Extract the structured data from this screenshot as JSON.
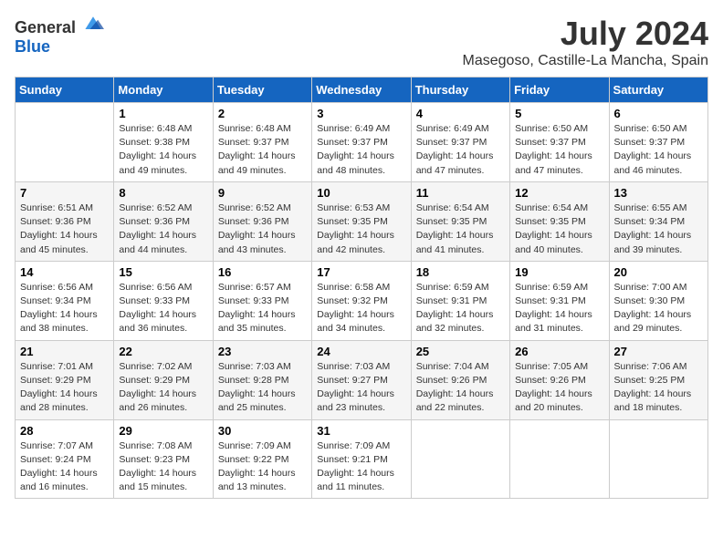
{
  "header": {
    "logo_general": "General",
    "logo_blue": "Blue",
    "title": "July 2024",
    "subtitle": "Masegoso, Castille-La Mancha, Spain"
  },
  "weekdays": [
    "Sunday",
    "Monday",
    "Tuesday",
    "Wednesday",
    "Thursday",
    "Friday",
    "Saturday"
  ],
  "weeks": [
    [
      {
        "day": "",
        "sunrise": "",
        "sunset": "",
        "daylight": ""
      },
      {
        "day": "1",
        "sunrise": "Sunrise: 6:48 AM",
        "sunset": "Sunset: 9:38 PM",
        "daylight": "Daylight: 14 hours and 49 minutes."
      },
      {
        "day": "2",
        "sunrise": "Sunrise: 6:48 AM",
        "sunset": "Sunset: 9:37 PM",
        "daylight": "Daylight: 14 hours and 49 minutes."
      },
      {
        "day": "3",
        "sunrise": "Sunrise: 6:49 AM",
        "sunset": "Sunset: 9:37 PM",
        "daylight": "Daylight: 14 hours and 48 minutes."
      },
      {
        "day": "4",
        "sunrise": "Sunrise: 6:49 AM",
        "sunset": "Sunset: 9:37 PM",
        "daylight": "Daylight: 14 hours and 47 minutes."
      },
      {
        "day": "5",
        "sunrise": "Sunrise: 6:50 AM",
        "sunset": "Sunset: 9:37 PM",
        "daylight": "Daylight: 14 hours and 47 minutes."
      },
      {
        "day": "6",
        "sunrise": "Sunrise: 6:50 AM",
        "sunset": "Sunset: 9:37 PM",
        "daylight": "Daylight: 14 hours and 46 minutes."
      }
    ],
    [
      {
        "day": "7",
        "sunrise": "Sunrise: 6:51 AM",
        "sunset": "Sunset: 9:36 PM",
        "daylight": "Daylight: 14 hours and 45 minutes."
      },
      {
        "day": "8",
        "sunrise": "Sunrise: 6:52 AM",
        "sunset": "Sunset: 9:36 PM",
        "daylight": "Daylight: 14 hours and 44 minutes."
      },
      {
        "day": "9",
        "sunrise": "Sunrise: 6:52 AM",
        "sunset": "Sunset: 9:36 PM",
        "daylight": "Daylight: 14 hours and 43 minutes."
      },
      {
        "day": "10",
        "sunrise": "Sunrise: 6:53 AM",
        "sunset": "Sunset: 9:35 PM",
        "daylight": "Daylight: 14 hours and 42 minutes."
      },
      {
        "day": "11",
        "sunrise": "Sunrise: 6:54 AM",
        "sunset": "Sunset: 9:35 PM",
        "daylight": "Daylight: 14 hours and 41 minutes."
      },
      {
        "day": "12",
        "sunrise": "Sunrise: 6:54 AM",
        "sunset": "Sunset: 9:35 PM",
        "daylight": "Daylight: 14 hours and 40 minutes."
      },
      {
        "day": "13",
        "sunrise": "Sunrise: 6:55 AM",
        "sunset": "Sunset: 9:34 PM",
        "daylight": "Daylight: 14 hours and 39 minutes."
      }
    ],
    [
      {
        "day": "14",
        "sunrise": "Sunrise: 6:56 AM",
        "sunset": "Sunset: 9:34 PM",
        "daylight": "Daylight: 14 hours and 38 minutes."
      },
      {
        "day": "15",
        "sunrise": "Sunrise: 6:56 AM",
        "sunset": "Sunset: 9:33 PM",
        "daylight": "Daylight: 14 hours and 36 minutes."
      },
      {
        "day": "16",
        "sunrise": "Sunrise: 6:57 AM",
        "sunset": "Sunset: 9:33 PM",
        "daylight": "Daylight: 14 hours and 35 minutes."
      },
      {
        "day": "17",
        "sunrise": "Sunrise: 6:58 AM",
        "sunset": "Sunset: 9:32 PM",
        "daylight": "Daylight: 14 hours and 34 minutes."
      },
      {
        "day": "18",
        "sunrise": "Sunrise: 6:59 AM",
        "sunset": "Sunset: 9:31 PM",
        "daylight": "Daylight: 14 hours and 32 minutes."
      },
      {
        "day": "19",
        "sunrise": "Sunrise: 6:59 AM",
        "sunset": "Sunset: 9:31 PM",
        "daylight": "Daylight: 14 hours and 31 minutes."
      },
      {
        "day": "20",
        "sunrise": "Sunrise: 7:00 AM",
        "sunset": "Sunset: 9:30 PM",
        "daylight": "Daylight: 14 hours and 29 minutes."
      }
    ],
    [
      {
        "day": "21",
        "sunrise": "Sunrise: 7:01 AM",
        "sunset": "Sunset: 9:29 PM",
        "daylight": "Daylight: 14 hours and 28 minutes."
      },
      {
        "day": "22",
        "sunrise": "Sunrise: 7:02 AM",
        "sunset": "Sunset: 9:29 PM",
        "daylight": "Daylight: 14 hours and 26 minutes."
      },
      {
        "day": "23",
        "sunrise": "Sunrise: 7:03 AM",
        "sunset": "Sunset: 9:28 PM",
        "daylight": "Daylight: 14 hours and 25 minutes."
      },
      {
        "day": "24",
        "sunrise": "Sunrise: 7:03 AM",
        "sunset": "Sunset: 9:27 PM",
        "daylight": "Daylight: 14 hours and 23 minutes."
      },
      {
        "day": "25",
        "sunrise": "Sunrise: 7:04 AM",
        "sunset": "Sunset: 9:26 PM",
        "daylight": "Daylight: 14 hours and 22 minutes."
      },
      {
        "day": "26",
        "sunrise": "Sunrise: 7:05 AM",
        "sunset": "Sunset: 9:26 PM",
        "daylight": "Daylight: 14 hours and 20 minutes."
      },
      {
        "day": "27",
        "sunrise": "Sunrise: 7:06 AM",
        "sunset": "Sunset: 9:25 PM",
        "daylight": "Daylight: 14 hours and 18 minutes."
      }
    ],
    [
      {
        "day": "28",
        "sunrise": "Sunrise: 7:07 AM",
        "sunset": "Sunset: 9:24 PM",
        "daylight": "Daylight: 14 hours and 16 minutes."
      },
      {
        "day": "29",
        "sunrise": "Sunrise: 7:08 AM",
        "sunset": "Sunset: 9:23 PM",
        "daylight": "Daylight: 14 hours and 15 minutes."
      },
      {
        "day": "30",
        "sunrise": "Sunrise: 7:09 AM",
        "sunset": "Sunset: 9:22 PM",
        "daylight": "Daylight: 14 hours and 13 minutes."
      },
      {
        "day": "31",
        "sunrise": "Sunrise: 7:09 AM",
        "sunset": "Sunset: 9:21 PM",
        "daylight": "Daylight: 14 hours and 11 minutes."
      },
      {
        "day": "",
        "sunrise": "",
        "sunset": "",
        "daylight": ""
      },
      {
        "day": "",
        "sunrise": "",
        "sunset": "",
        "daylight": ""
      },
      {
        "day": "",
        "sunrise": "",
        "sunset": "",
        "daylight": ""
      }
    ]
  ]
}
